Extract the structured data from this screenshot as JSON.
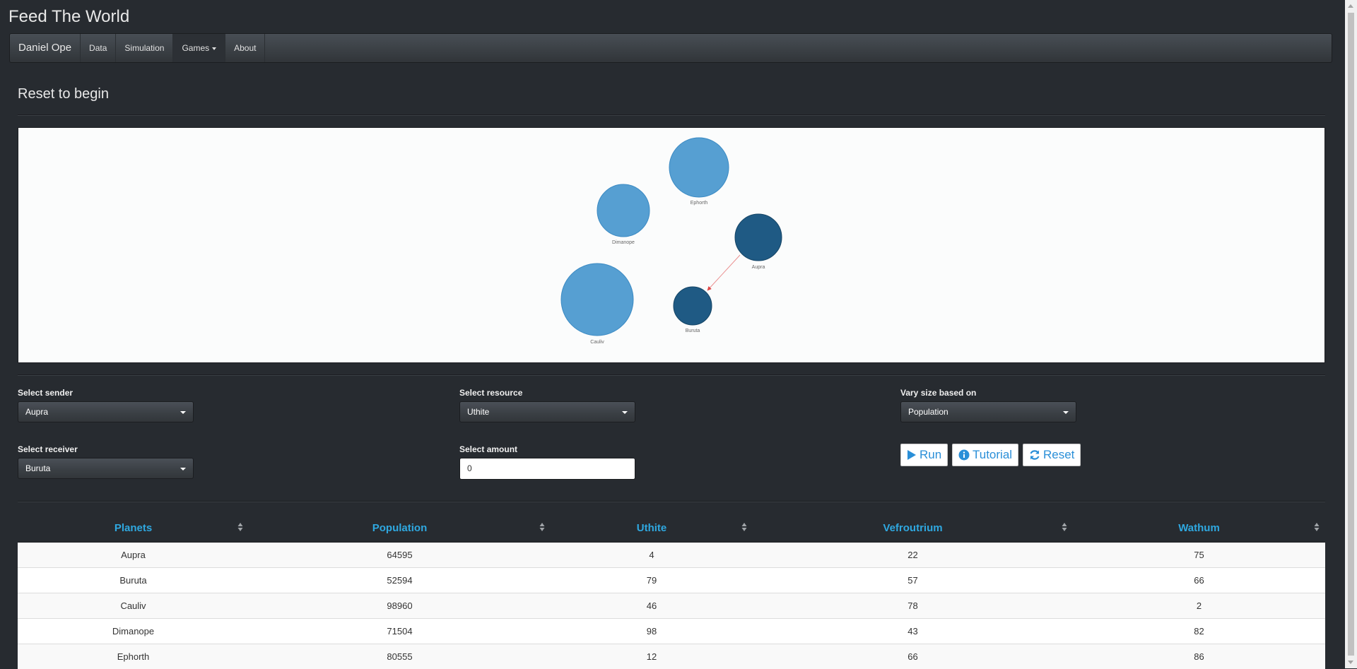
{
  "app": {
    "title": "Feed The World"
  },
  "nav": {
    "brand": "Daniel Ope",
    "items": [
      {
        "label": "Data"
      },
      {
        "label": "Simulation"
      },
      {
        "label": "Games"
      },
      {
        "label": "About"
      }
    ]
  },
  "section": {
    "title": "Reset to begin"
  },
  "visualization": {
    "node_color": "#569fd2",
    "selected_color": "#1f5a84",
    "link_color": "#e04848",
    "nodes": [
      {
        "label": "Ephorth",
        "selected": false
      },
      {
        "label": "Dimanope",
        "selected": false
      },
      {
        "label": "Aupra",
        "selected": true
      },
      {
        "label": "Cauliv",
        "selected": false
      },
      {
        "label": "Buruta",
        "selected": true
      }
    ],
    "link": {
      "from": "Aupra",
      "to": "Buruta"
    }
  },
  "controls": {
    "sender": {
      "label": "Select sender",
      "value": "Aupra"
    },
    "receiver": {
      "label": "Select receiver",
      "value": "Buruta"
    },
    "resource": {
      "label": "Select resource",
      "value": "Uthite"
    },
    "amount": {
      "label": "Select amount",
      "value": "0"
    },
    "size": {
      "label": "Vary size based on",
      "value": "Population"
    },
    "buttons": {
      "run": "Run",
      "tutorial": "Tutorial",
      "reset": "Reset"
    }
  },
  "table": {
    "headers": [
      "Planets",
      "Population",
      "Uthite",
      "Vefroutrium",
      "Wathum"
    ],
    "rows": [
      [
        "Aupra",
        "64595",
        "4",
        "22",
        "75"
      ],
      [
        "Buruta",
        "52594",
        "79",
        "57",
        "66"
      ],
      [
        "Cauliv",
        "98960",
        "46",
        "78",
        "2"
      ],
      [
        "Dimanope",
        "71504",
        "98",
        "43",
        "82"
      ],
      [
        "Ephorth",
        "80555",
        "12",
        "66",
        "86"
      ]
    ]
  }
}
